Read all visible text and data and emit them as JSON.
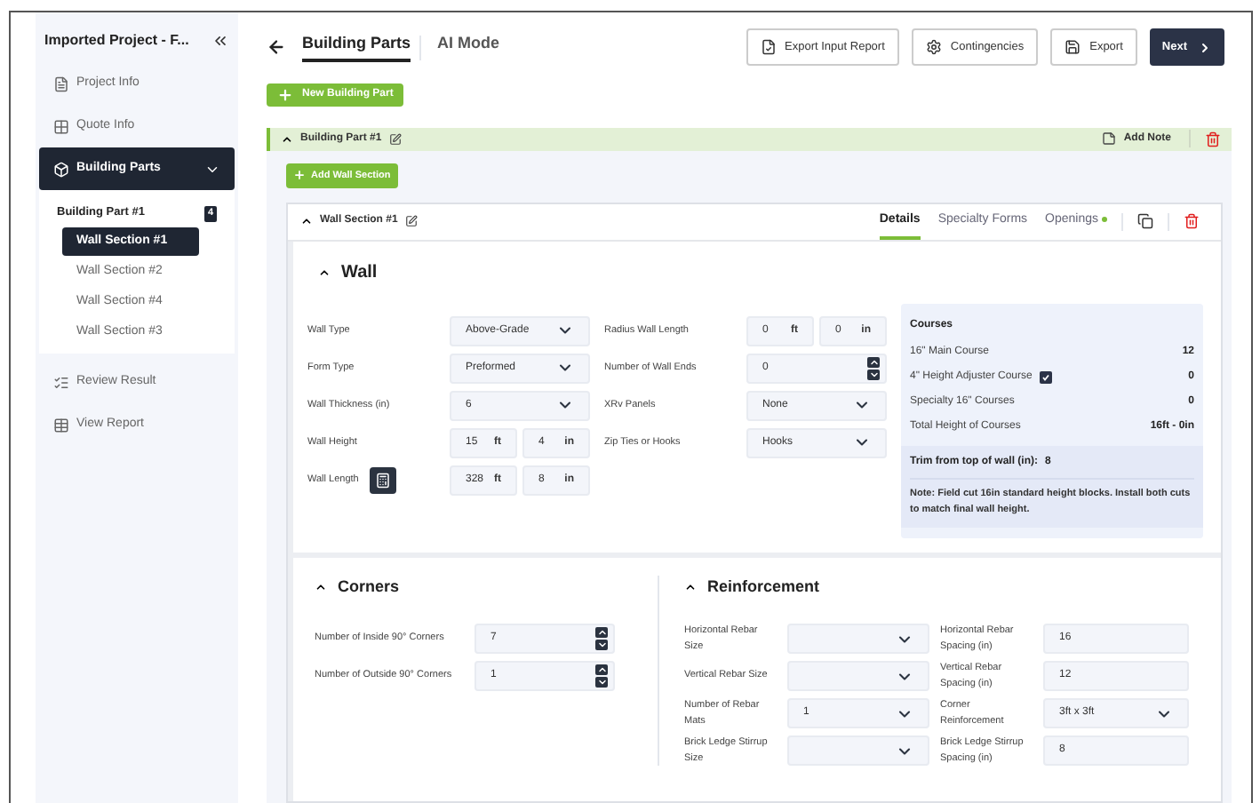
{
  "sidebar": {
    "title": "Imported Project - F...",
    "nav": [
      {
        "label": "Project Info",
        "selected": false
      },
      {
        "label": "Quote Info",
        "selected": false
      },
      {
        "label": "Building Parts",
        "selected": true,
        "expanded": true,
        "children": [
          {
            "label": "Building Part #1",
            "badge": "4",
            "children": [
              {
                "label": "Wall Section #1",
                "selected": true
              },
              {
                "label": "Wall Section #2",
                "selected": false
              },
              {
                "label": "Wall Section #4",
                "selected": false
              },
              {
                "label": "Wall Section #3",
                "selected": false
              }
            ]
          }
        ]
      },
      {
        "label": "Review Result",
        "selected": false
      },
      {
        "label": "View Report",
        "selected": false
      }
    ]
  },
  "header": {
    "tabs": [
      {
        "label": "Building Parts",
        "selected": true
      },
      {
        "label": "AI Mode",
        "selected": false
      }
    ],
    "buttons": [
      {
        "label": "Export Input Report",
        "kind": "outline"
      },
      {
        "label": "Contingencies",
        "kind": "outline"
      },
      {
        "label": "Export",
        "kind": "outline"
      },
      {
        "label": "Next",
        "kind": "primary"
      }
    ]
  },
  "new_building_part": "New Building Part",
  "building_part": {
    "title": "Building Part #1",
    "expanded": true,
    "add_note": "Add Note",
    "add_wall_section": "Add Wall Section",
    "wall_section": {
      "title": "Wall Section #1",
      "expanded": true,
      "tabs": [
        {
          "label": "Details",
          "selected": true,
          "indicator": false
        },
        {
          "label": "Specialty Forms",
          "selected": false,
          "indicator": false
        },
        {
          "label": "Openings",
          "selected": false,
          "indicator": true
        }
      ],
      "wall": {
        "title": "Wall",
        "fields_left": [
          {
            "label": "Wall Type",
            "kind": "select",
            "value": "Above-Grade"
          },
          {
            "label": "Form Type",
            "kind": "select",
            "value": "Preformed"
          },
          {
            "label": "Wall Thickness (in)",
            "kind": "select",
            "value": "6"
          },
          {
            "label": "Wall Height",
            "kind": "length",
            "feet": "15",
            "feet_unit": "ft",
            "inches": "4",
            "inches_unit": "in"
          },
          {
            "label": "Wall Length",
            "kind": "length",
            "calculator": true,
            "feet": "328",
            "feet_unit": "ft",
            "inches": "8",
            "inches_unit": "in"
          }
        ],
        "fields_right": [
          {
            "label": "Radius Wall Length",
            "kind": "length",
            "feet": "0",
            "feet_unit": "ft",
            "inches": "0",
            "inches_unit": "in"
          },
          {
            "label": "Number of Wall Ends",
            "kind": "spinner",
            "value": "0"
          },
          {
            "label": "XRv Panels",
            "kind": "select",
            "value": "None"
          },
          {
            "label": "Zip Ties or Hooks",
            "kind": "select",
            "value": "Hooks"
          }
        ],
        "courses": {
          "title": "Courses",
          "rows": [
            {
              "label": "16\" Main Course",
              "value": "12"
            },
            {
              "label": "4\" Height Adjuster Course",
              "value": "0",
              "checked": true
            },
            {
              "label": "Specialty 16\" Courses",
              "value": "0"
            },
            {
              "label": "Total Height of Courses",
              "value": "16ft - 0in"
            }
          ],
          "trim_label": "Trim from top of wall (in):",
          "trim_value": "8",
          "note": "Note: Field cut 16in standard height blocks. Install both cuts to match final wall height."
        }
      },
      "corners": {
        "title": "Corners",
        "fields": [
          {
            "label": "Number of Inside 90° Corners",
            "kind": "spinner",
            "value": "7"
          },
          {
            "label": "Number of Outside 90° Corners",
            "kind": "spinner",
            "value": "1"
          }
        ]
      },
      "reinforcement": {
        "title": "Reinforcement",
        "columns": [
          [
            {
              "label": "Horizontal Rebar Size",
              "kind": "select"
            },
            {
              "label": "Vertical Rebar Size",
              "kind": "select"
            },
            {
              "label": "Number of Rebar Mats",
              "kind": "select",
              "value": "1"
            },
            {
              "label": "Brick Ledge Stirrup Size",
              "kind": "select"
            }
          ],
          [
            {
              "label": "Horizontal Rebar Spacing (in)",
              "kind": "text",
              "value": "16"
            },
            {
              "label": "Vertical Rebar Spacing (in)",
              "kind": "text",
              "value": "12"
            },
            {
              "label": "Corner Reinforcement",
              "kind": "select",
              "value": "3ft x 3ft"
            },
            {
              "label": "Brick Ledge Stirrup Spacing (in)",
              "kind": "text",
              "value": "8"
            }
          ]
        ]
      }
    }
  }
}
